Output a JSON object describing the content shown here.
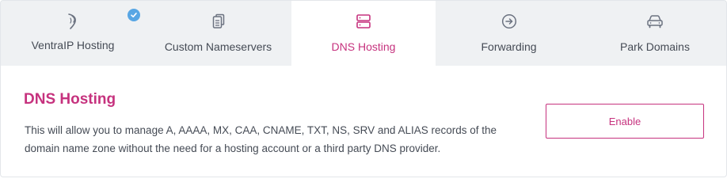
{
  "tabs": [
    {
      "label": "VentraIP Hosting",
      "icon": "ventraip-logo-icon",
      "active": false,
      "checked": true
    },
    {
      "label": "Custom Nameservers",
      "icon": "documents-icon",
      "active": false
    },
    {
      "label": "DNS Hosting",
      "icon": "server-icon",
      "active": true
    },
    {
      "label": "Forwarding",
      "icon": "arrow-circle-right-icon",
      "active": false
    },
    {
      "label": "Park Domains",
      "icon": "car-icon",
      "active": false
    }
  ],
  "panel": {
    "title": "DNS Hosting",
    "description_line1": "This will allow you to manage A, AAAA, MX, CAA, CNAME, TXT, NS, SRV and ALIAS records of the",
    "description_line2": "domain name zone without the need for a hosting account or a third party DNS provider.",
    "enable_label": "Enable"
  },
  "colors": {
    "accent": "#c6327e",
    "badge": "#58a6e4",
    "tab_bar_bg": "#eff1f3",
    "text": "#454b55"
  }
}
